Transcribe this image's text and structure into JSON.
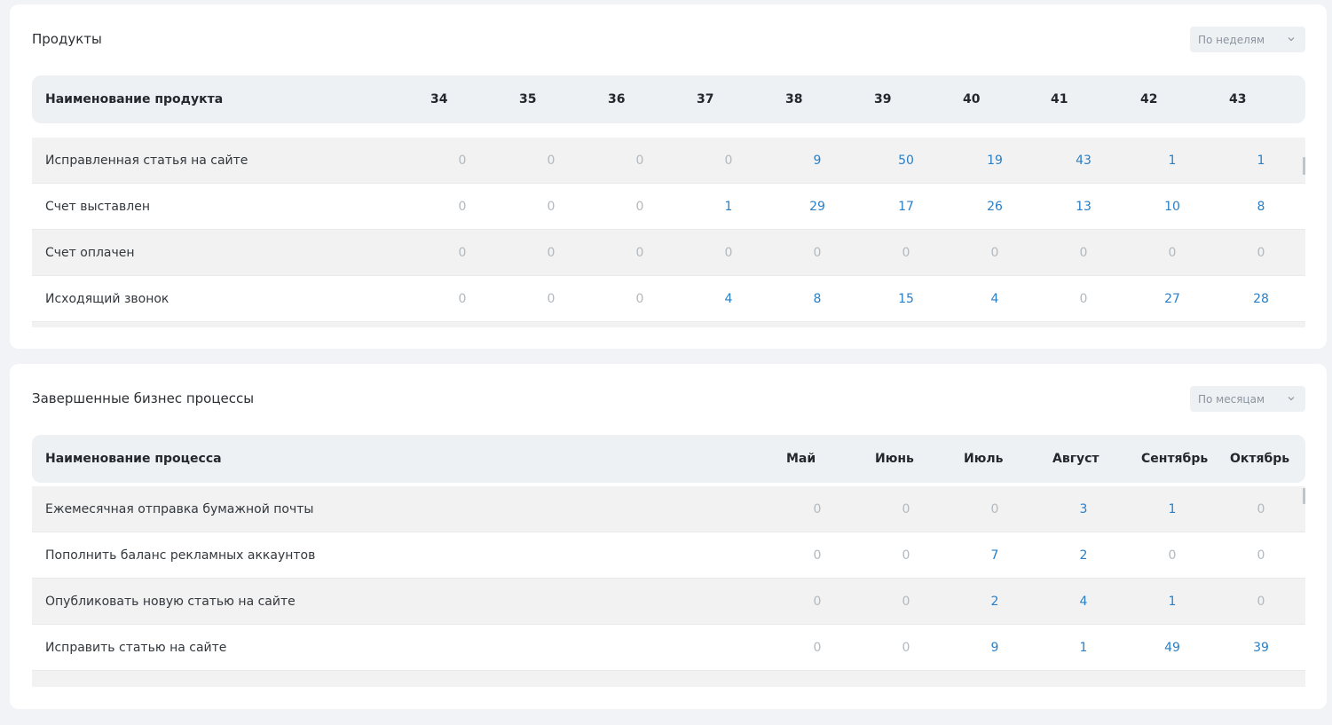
{
  "products": {
    "title": "Продукты",
    "period_select": {
      "value": "По неделям",
      "icon": "chevron-down-icon"
    },
    "header": {
      "name_label": "Наименование продукта",
      "columns": [
        "34",
        "35",
        "36",
        "37",
        "38",
        "39",
        "40",
        "41",
        "42",
        "43"
      ]
    },
    "rows": [
      {
        "name": "Исправленная статья на сайте",
        "values": [
          0,
          0,
          0,
          0,
          9,
          50,
          19,
          43,
          1,
          1
        ]
      },
      {
        "name": "Счет выставлен",
        "values": [
          0,
          0,
          0,
          1,
          29,
          17,
          26,
          13,
          10,
          8
        ]
      },
      {
        "name": "Счет оплачен",
        "values": [
          0,
          0,
          0,
          0,
          0,
          0,
          0,
          0,
          0,
          0
        ]
      },
      {
        "name": "Исходящий звонок",
        "values": [
          0,
          0,
          0,
          4,
          8,
          15,
          4,
          0,
          27,
          28
        ]
      }
    ]
  },
  "processes": {
    "title": "Завершенные бизнес процессы",
    "period_select": {
      "value": "По месяцам",
      "icon": "chevron-down-icon"
    },
    "header": {
      "name_label": "Наименование процесса",
      "columns": [
        "Май",
        "Июнь",
        "Июль",
        "Август",
        "Сентябрь",
        "Октябрь"
      ]
    },
    "rows": [
      {
        "name": "Ежемесячная отправка бумажной почты",
        "values": [
          0,
          0,
          0,
          3,
          1,
          0
        ]
      },
      {
        "name": "Пополнить баланс рекламных аккаунтов",
        "values": [
          0,
          0,
          7,
          2,
          0,
          0
        ]
      },
      {
        "name": "Опубликовать новую статью на сайте",
        "values": [
          0,
          0,
          2,
          4,
          1,
          0
        ]
      },
      {
        "name": "Исправить статью на сайте",
        "values": [
          0,
          0,
          9,
          1,
          49,
          39
        ]
      }
    ]
  },
  "colors": {
    "zero_value": "#b2b8be",
    "positive_value": "#2a7fc6",
    "header_bg": "#eef1f4",
    "alt_row_bg": "#f2f2f2"
  }
}
